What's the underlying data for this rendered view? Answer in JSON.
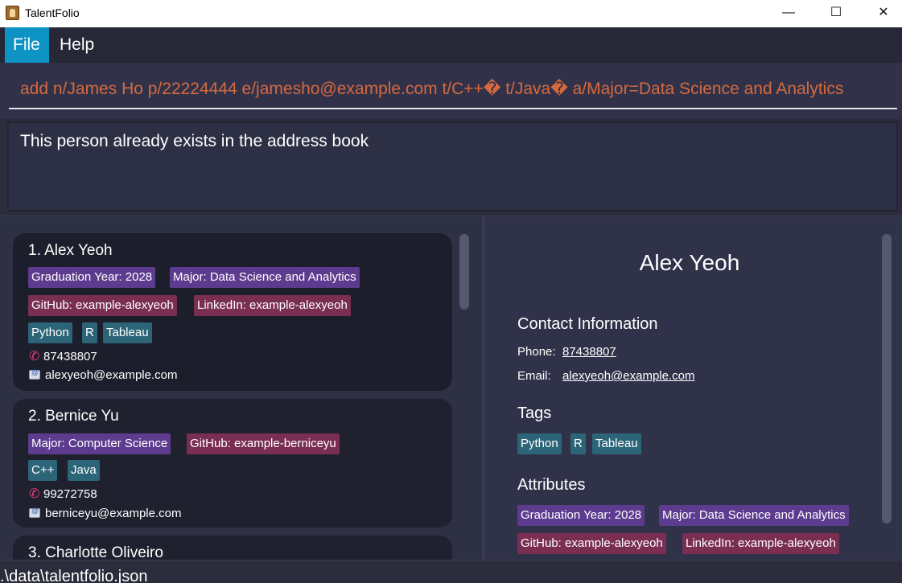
{
  "window": {
    "title": "TalentFolio",
    "minimize": "—",
    "maximize": "☐",
    "close": "✕"
  },
  "menu": {
    "file": "File",
    "help": "Help"
  },
  "command": {
    "value": "add n/James Ho p/22224444 e/jamesho@example.com t/C++� t/Java� a/Major=Data Science and Analytics"
  },
  "result": {
    "text": "This person already exists in the address book"
  },
  "persons": [
    {
      "name": "1. Alex Yeoh",
      "attributes": [
        "Graduation Year: 2028",
        "Major: Data Science and Analytics"
      ],
      "links": [
        "GitHub: example-alexyeoh",
        "LinkedIn: example-alexyeoh"
      ],
      "tags": [
        "Python",
        "R",
        "Tableau"
      ],
      "phone": "87438807",
      "email": "alexyeoh@example.com"
    },
    {
      "name": "2. Bernice Yu",
      "attributes": [
        "Major: Computer Science"
      ],
      "links": [
        "GitHub: example-berniceyu"
      ],
      "tags": [
        "C++",
        "Java"
      ],
      "phone": "99272758",
      "email": "berniceyu@example.com"
    },
    {
      "name": "3. Charlotte Oliveiro"
    }
  ],
  "detail": {
    "name": "Alex Yeoh",
    "contact_heading": "Contact Information",
    "phone_label": "Phone:",
    "phone": "87438807",
    "email_label": "Email:",
    "email": "alexyeoh@example.com",
    "tags_heading": "Tags",
    "tags": [
      "Python",
      "R",
      "Tableau"
    ],
    "attributes_heading": "Attributes",
    "attributes": [
      "Graduation Year: 2028",
      "Major: Data Science and Analytics",
      "GitHub: example-alexyeoh",
      "LinkedIn: example-alexyeoh"
    ]
  },
  "status": {
    "path": ".\\data\\talentfolio.json"
  },
  "colors": {
    "accent": "#0e93c5",
    "command_text": "#d6693d",
    "attribute_chip": "#5d3b8e",
    "link_chip": "#7a2f52",
    "tag_chip": "#2c6478"
  },
  "icons": {
    "phone": "phone-icon",
    "email": "email-icon"
  }
}
